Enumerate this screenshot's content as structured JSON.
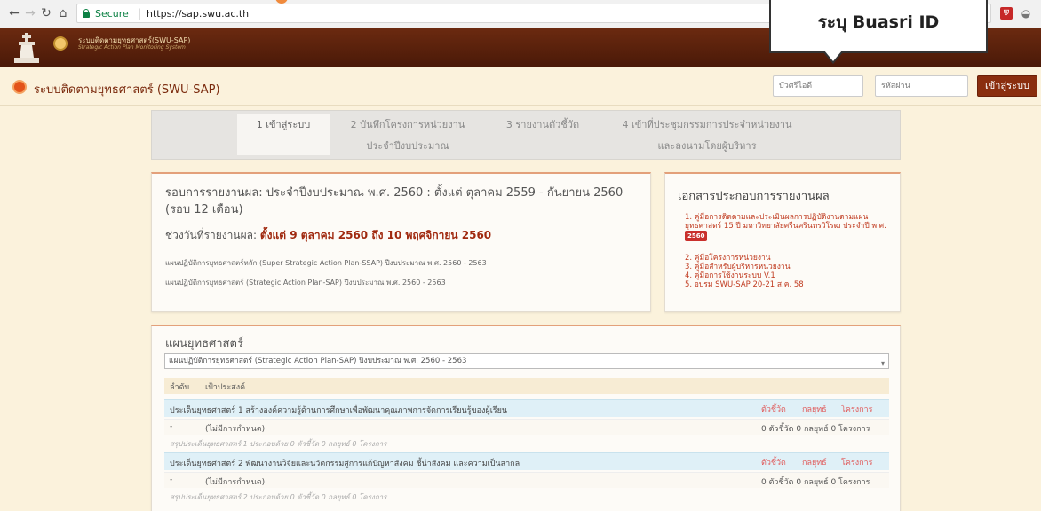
{
  "browser": {
    "secure_label": "Secure",
    "url": "https://sap.swu.ac.th"
  },
  "callout": {
    "text": "ระบุ Buasri ID"
  },
  "banner": {
    "title": "ระบบติดตามยุทธศาสตร์(SWU-SAP)",
    "subtitle": "Strategic Action Plan Monitoring System"
  },
  "header": {
    "title": "ระบบติดตามยุทธศาสตร์ (SWU-SAP)",
    "login_id_placeholder": "บัวศรีไอดี",
    "password_placeholder": "รหัสผ่าน",
    "login_button": "เข้าสู่ระบบ"
  },
  "steps": [
    {
      "line1": "1 เข้าสู่ระบบ",
      "line2": ""
    },
    {
      "line1": "2 บันทึกโครงการหน่วยงาน",
      "line2": "ประจำปีงบประมาณ"
    },
    {
      "line1": "3 รายงานตัวชี้วัด",
      "line2": ""
    },
    {
      "line1": "4 เข้าที่ประชุมกรรมการประจำหน่วยงาน",
      "line2": "และลงนามโดยผู้บริหาร"
    }
  ],
  "report": {
    "round": "รอบการรายงานผล: ประจำปีงบประมาณ พ.ศ. 2560 : ตั้งแต่ ตุลาคม 2559 - กันยายน 2560 (รอบ 12 เดือน)",
    "period_label": "ช่วงวันที่รายงานผล:",
    "period_value": "ตั้งแต่ 9 ตุลาคม 2560 ถึง 10 พฤศจิกายน 2560",
    "plan1": "แผนปฏิบัติการยุทธศาสตร์หลัก (Super Strategic Action Plan-SSAP) ปีงบประมาณ พ.ศ. 2560 - 2563",
    "plan2": "แผนปฏิบัติการยุทธศาสตร์ (Strategic Action Plan-SAP) ปีงบประมาณ พ.ศ. 2560 - 2563"
  },
  "docs": {
    "title": "เอกสารประกอบการรายงานผล",
    "item1": "1. คู่มือการติดตามและประเมินผลการปฏิบัติงานตามแผนยุทธศาสตร์ 15 ปี มหาวิทยาลัยศรีนครินทรวิโรฒ ประจำปี พ.ศ.",
    "item1_badge": "2560",
    "item2": "2. คู่มือโครงการหน่วยงาน",
    "item3": "3. คู่มือสำหรับผู้บริหารหน่วยงาน",
    "item4": "4. คู่มือการใช้งานระบบ V.1",
    "item5": "5. อบรม SWU-SAP 20-21 ส.ค. 58"
  },
  "strategy": {
    "title": "แผนยุทธศาสตร์",
    "selected": "แผนปฏิบัติการยุทธศาสตร์ (Strategic Action Plan-SAP) ปีงบประมาณ พ.ศ. 2560 - 2563",
    "col_order": "ลำดับ",
    "col_goal": "เป้าประสงค์",
    "link_kpi": "ตัวชี้วัด",
    "link_tactic": "กลยุทธ์",
    "link_project": "โครงการ",
    "issues": [
      {
        "title": "ประเด็นยุทธศาสตร์ 1 สร้างองค์ความรู้ด้านการศึกษาเพื่อพัฒนาคุณภาพการจัดการเรียนรู้ของผู้เรียน",
        "dash": "-",
        "undefined": "(ไม่มีการกำหนด)",
        "counts": "0 ตัวชี้วัด  0 กลยุทธ์  0 โครงการ",
        "summary": "สรุปประเด็นยุทธศาสตร์ 1 ประกอบด้วย 0 ตัวชี้วัด 0 กลยุทธ์ 0 โครงการ"
      },
      {
        "title": "ประเด็นยุทธศาสตร์ 2 พัฒนางานวิจัยและนวัตกรรมสู่การแก้ปัญหาสังคม ชี้นำสังคม และความเป็นสากล",
        "dash": "-",
        "undefined": "(ไม่มีการกำหนด)",
        "counts": "0 ตัวชี้วัด  0 กลยุทธ์  0 โครงการ",
        "summary": "สรุปประเด็นยุทธศาสตร์ 2 ประกอบด้วย 0 ตัวชี้วัด 0 กลยุทธ์ 0 โครงการ"
      }
    ]
  },
  "colors": {
    "banner": "#5a200c",
    "accent": "#8a2e0e",
    "page_bg": "#fbf2dc",
    "issue_row": "#dff0f7"
  }
}
